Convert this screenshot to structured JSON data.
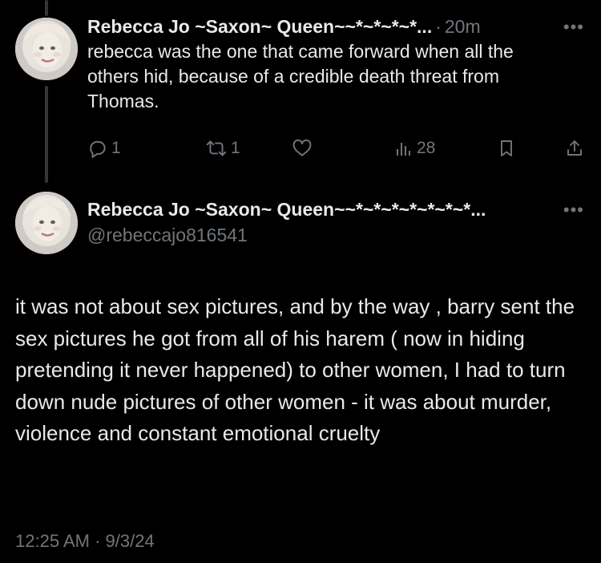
{
  "reply_tweet": {
    "author_name": "Rebecca Jo ~Saxon~ Queen~~*~*~*~*...",
    "separator": "·",
    "time_ago": "20m",
    "more_label": "•••",
    "text": "rebecca was the one that came forward when all the others hid, because of a credible death threat from Thomas.",
    "actions": {
      "replies": "1",
      "reposts": "1",
      "likes": "",
      "views": "28"
    },
    "icons": [
      "reply-icon",
      "repost-icon",
      "like-icon",
      "views-icon",
      "bookmark-icon",
      "share-icon"
    ]
  },
  "main_tweet": {
    "author_name": "Rebecca Jo ~Saxon~ Queen~~*~*~*~*~*~*~*...",
    "handle": "@rebeccajo816541",
    "more_label": "•••",
    "text": "it was not about sex pictures, and by the way , barry sent the sex pictures he got from all of his harem ( now in  hiding pretending it never happened) to other women, I had to turn down nude pictures of other women - it was about murder, violence and constant emotional cruelty",
    "timestamp": "12:25 AM · 9/3/24"
  },
  "colors": {
    "background": "#000000",
    "primary_text": "#e7e9ea",
    "secondary_text": "#71767b",
    "thread_line": "#333639"
  }
}
